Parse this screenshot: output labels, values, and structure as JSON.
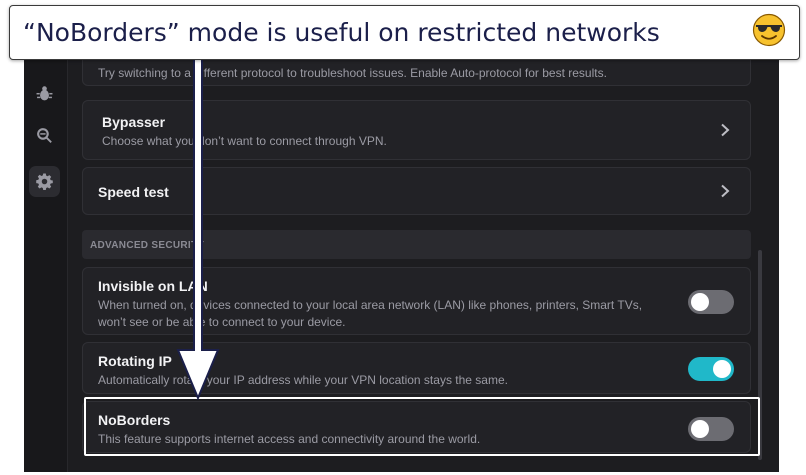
{
  "banner": {
    "text": "“NoBorders” mode is useful on restricted networks",
    "emoji": "smiling-face-with-sunglasses"
  },
  "sidebar": {
    "items": [
      {
        "icon": "bug-icon",
        "active": false
      },
      {
        "icon": "search-minus-icon",
        "active": false
      },
      {
        "icon": "gear-icon",
        "active": true
      }
    ]
  },
  "settings": {
    "protocol_hint": "Try switching to a different protocol to troubleshoot issues. Enable Auto-protocol for best results.",
    "bypasser": {
      "title": "Bypasser",
      "description": "Choose what you don’t want to connect through VPN."
    },
    "speed_test": {
      "title": "Speed test"
    },
    "advanced_security_label": "ADVANCED SECURITY",
    "invisible_on_lan": {
      "title": "Invisible on LAN",
      "description_line1": "When turned on, devices connected to your local area network (LAN) like phones, printers, Smart TVs,",
      "description_line2": "won’t see or be able to connect to your device.",
      "enabled": false
    },
    "rotating_ip": {
      "title": "Rotating IP",
      "description": "Automatically rotate your IP address while your VPN location stays the same.",
      "enabled": true
    },
    "noborders": {
      "title": "NoBorders",
      "description": "This feature supports internet access and connectivity around the world.",
      "enabled": false
    }
  },
  "colors": {
    "accent": "#20b8c9",
    "background": "#1d1d20",
    "card": "#222226",
    "banner_text": "#1b1f4a"
  }
}
